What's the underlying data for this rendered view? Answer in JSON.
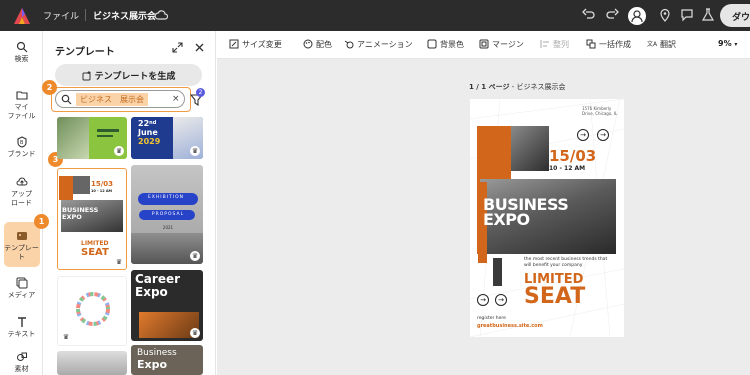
{
  "topbar": {
    "file_menu": "ファイル",
    "document_title": "ビジネス展示会",
    "download_label": "ダウ"
  },
  "rail": {
    "items": [
      {
        "label": "検索",
        "icon": "search-icon"
      },
      {
        "label": "マイファイル",
        "line1": "マイ",
        "line2": "ファイル",
        "icon": "folder-icon"
      },
      {
        "label": "ブランド",
        "icon": "brand-icon"
      },
      {
        "label": "アップロード",
        "line1": "アップ",
        "line2": "ロード",
        "icon": "upload-icon"
      },
      {
        "label": "テンプレート",
        "line1": "テンプレー",
        "line2": "ト",
        "icon": "template-icon",
        "active": true
      },
      {
        "label": "メディア",
        "icon": "media-icon"
      },
      {
        "label": "テキスト",
        "icon": "text-icon"
      },
      {
        "label": "素材",
        "icon": "elements-icon"
      }
    ]
  },
  "panel": {
    "title": "テンプレート",
    "generate_button": "テンプレートを生成",
    "search_value": "ビジネス　展示会",
    "filter_badge": "2",
    "steps": [
      "1",
      "2",
      "3"
    ]
  },
  "thumbnails": {
    "t2_line1": "22",
    "t2_line1_sup": "nd",
    "t2_line2": "June",
    "t2_line3": "2029",
    "t3_date": "15/03",
    "t3_time": "10 - 12 AM",
    "t3_title": "BUSINESS EXPO",
    "t3_limited": "LIMITED",
    "t3_seat": "SEAT",
    "t4_line1": "EXHIBITION",
    "t4_line2": "PROPOSAL",
    "t4_line3": "2021",
    "t6_line1": "Career",
    "t6_line2": "Expo",
    "t8_line1": "Business",
    "t8_line2": "Expo"
  },
  "toolbar": {
    "resize": "サイズ変更",
    "layout": "配色",
    "animation": "アニメーション",
    "background": "背景色",
    "margin": "マージン",
    "arrange": "整列",
    "batch": "一括作成",
    "translate": "翻訳",
    "zoom": "9%"
  },
  "canvas": {
    "page_indicator": "1 / 1 ページ",
    "page_name": " - ビジネス展示会"
  },
  "poster": {
    "address": "1576 Kimberly Drive, Chicago, IL",
    "date": "15/03",
    "time": "10 - 12 AM",
    "title_line1": "BUSINESS",
    "title_line2": "EXPO",
    "description": "the most recent business trends that will benefit your company",
    "limited": "LIMITED",
    "seat": "SEAT",
    "register": "register here",
    "url": "greatbusiness.site.com"
  },
  "colors": {
    "accent": "#d2671b",
    "highlight": "#f19b47",
    "topbar": "#2c2c2c",
    "canvas": "#ececec"
  }
}
